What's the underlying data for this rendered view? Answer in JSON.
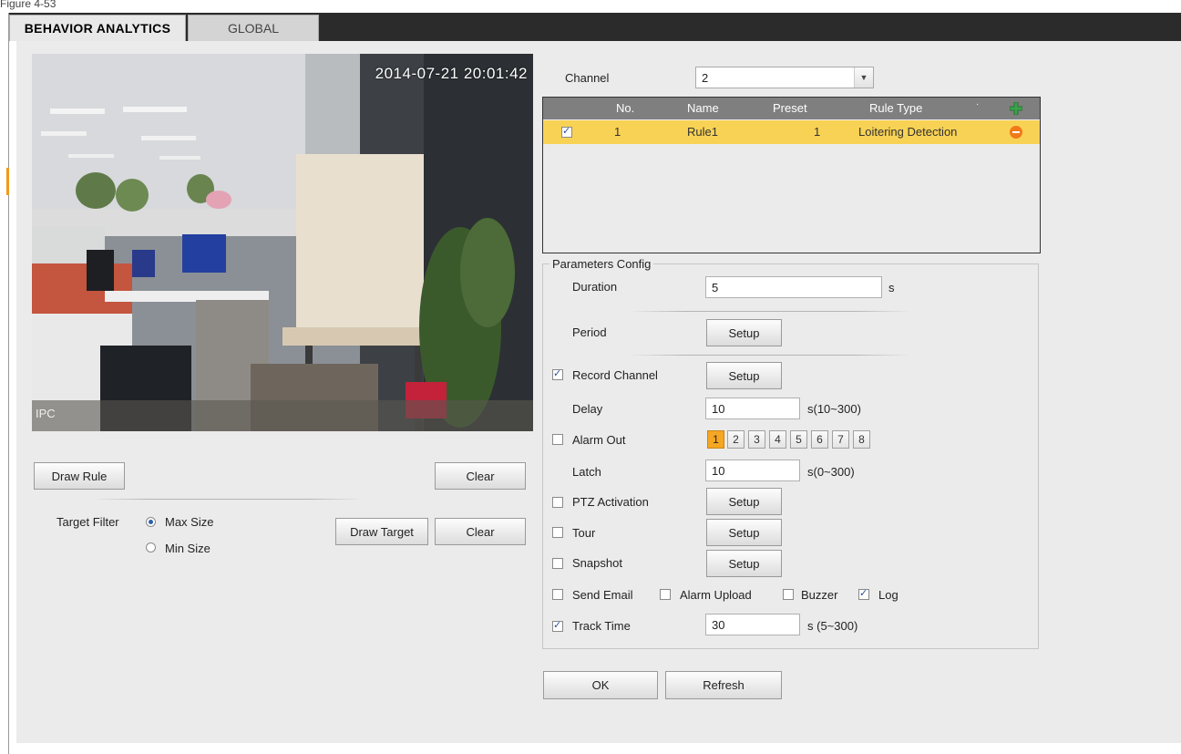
{
  "top_caption": "Figure 4-53",
  "tabs": [
    {
      "label": "BEHAVIOR ANALYTICS",
      "active": true
    },
    {
      "label": "GLOBAL",
      "active": false
    }
  ],
  "video": {
    "timestamp": "2014-07-21 20:01:42",
    "camera_label": "IPC"
  },
  "left_controls": {
    "draw_rule": "Draw Rule",
    "clear_rule": "Clear",
    "target_filter_label": "Target Filter",
    "max_size": "Max Size",
    "min_size": "Min Size",
    "target_filter_selected": "Max Size",
    "draw_target": "Draw Target",
    "clear_target": "Clear"
  },
  "channel": {
    "label": "Channel",
    "value": "2"
  },
  "rule_table": {
    "headers": [
      "No.",
      "Name",
      "Preset",
      "Rule Type"
    ],
    "rows": [
      {
        "checked": true,
        "no": "1",
        "name": "Rule1",
        "preset": "1",
        "rule_type": "Loitering Detection"
      }
    ]
  },
  "params": {
    "title": "Parameters Config",
    "duration_label": "Duration",
    "duration_value": "5",
    "duration_unit": "s",
    "period_label": "Period",
    "setup": "Setup",
    "record_channel_label": "Record Channel",
    "record_channel_checked": true,
    "delay_label": "Delay",
    "delay_value": "10",
    "delay_range": "s(10~300)",
    "alarm_out_label": "Alarm Out",
    "alarm_out_checked": false,
    "alarm_outputs": [
      "1",
      "2",
      "3",
      "4",
      "5",
      "6",
      "7",
      "8"
    ],
    "alarm_output_selected": "1",
    "latch_label": "Latch",
    "latch_value": "10",
    "latch_range": "s(0~300)",
    "ptz_label": "PTZ Activation",
    "tour_label": "Tour",
    "snapshot_label": "Snapshot",
    "send_email_label": "Send Email",
    "alarm_upload_label": "Alarm Upload",
    "buzzer_label": "Buzzer",
    "log_label": "Log",
    "log_checked": true,
    "track_time_label": "Track Time",
    "track_time_checked": true,
    "track_time_value": "30",
    "track_time_range": "s (5~300)"
  },
  "footer": {
    "ok": "OK",
    "refresh": "Refresh"
  },
  "colors": {
    "tabbar": "#2b2b2b",
    "panel": "#ebebeb",
    "selected_row": "#f8d254",
    "table_header": "#7f7f7f",
    "alarm_selected": "#f5a623",
    "add_icon": "#3aa14a",
    "remove_icon": "#f07a1a"
  },
  "icons": [
    "add-rule-icon",
    "remove-rule-icon",
    "dropdown-arrow-icon"
  ]
}
